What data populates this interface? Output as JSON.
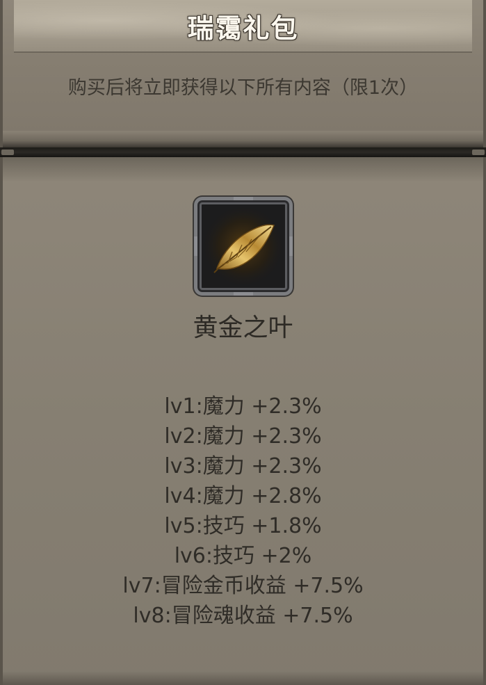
{
  "header": {
    "title": "瑞霭礼包",
    "subtitle": "购买后将立即获得以下所有内容（限1次）"
  },
  "item": {
    "icon": "golden-leaf-icon",
    "name": "黄金之叶"
  },
  "stats": [
    "lv1:魔力 +2.3%",
    "lv2:魔力 +2.3%",
    "lv3:魔力 +2.3%",
    "lv4:魔力 +2.8%",
    "lv5:技巧 +1.8%",
    "lv6:技巧 +2%",
    "lv7:冒险金币收益 +7.5%",
    "lv8:冒险魂收益 +7.5%"
  ],
  "colors": {
    "panel": "#867f72",
    "title_text": "#fbf7ee",
    "body_text": "#2f2c27",
    "leaf_gold": "#d4a640"
  }
}
